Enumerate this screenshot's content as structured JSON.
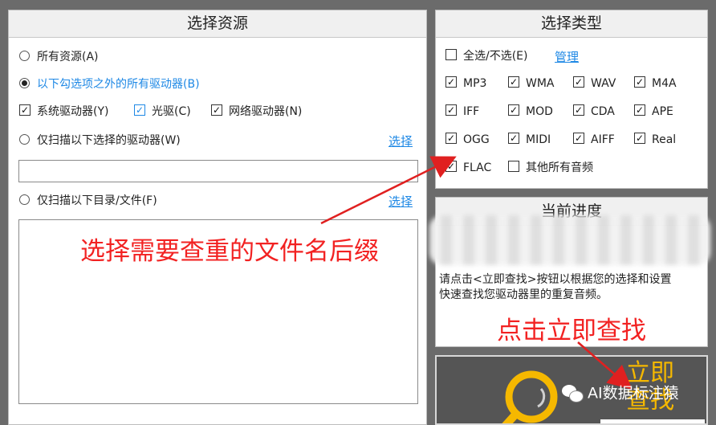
{
  "source_panel": {
    "title": "选择资源",
    "opt_all": "所有资源(A)",
    "opt_except": "以下勾选项之外的所有驱动器(B)",
    "chk_system": "系统驱动器(Y)",
    "chk_cdrom": "光驱(C)",
    "chk_network": "网络驱动器(N)",
    "opt_selected_drives": "仅扫描以下选择的驱动器(W)",
    "select_link_1": "选择",
    "opt_dir_files": "仅扫描以下目录/文件(F)",
    "select_link_2": "选择"
  },
  "type_panel": {
    "title": "选择类型",
    "select_all": "全选/不选(E)",
    "manage_link": "管理",
    "types": [
      {
        "label": "MP3",
        "checked": true
      },
      {
        "label": "WMA",
        "checked": true
      },
      {
        "label": "WAV",
        "checked": true
      },
      {
        "label": "M4A",
        "checked": true
      },
      {
        "label": "IFF",
        "checked": true
      },
      {
        "label": "MOD",
        "checked": true
      },
      {
        "label": "CDA",
        "checked": true
      },
      {
        "label": "APE",
        "checked": true
      },
      {
        "label": "OGG",
        "checked": true
      },
      {
        "label": "MIDI",
        "checked": true
      },
      {
        "label": "AIFF",
        "checked": true
      },
      {
        "label": "Real",
        "checked": true
      },
      {
        "label": "FLAC",
        "checked": true
      },
      {
        "label": "其他所有音频",
        "checked": false
      }
    ]
  },
  "progress_panel": {
    "title": "当前进度",
    "hint_line1": "请点击<立即查找>按钮以根据您的选择和设置",
    "hint_line2": "快速查找您驱动器里的重复音频。"
  },
  "search_button": {
    "label_line1": "立即",
    "label_line2": "查找"
  },
  "annotations": {
    "suffix_note": "选择需要查重的文件名后缀",
    "click_note": "点击立即查找"
  },
  "watermark": {
    "text": "AI数据标注猿"
  },
  "colors": {
    "background": "#6b6b6b",
    "link_blue": "#1e88e5",
    "annotation_red": "#f22222",
    "button_gold": "#f5b800"
  }
}
